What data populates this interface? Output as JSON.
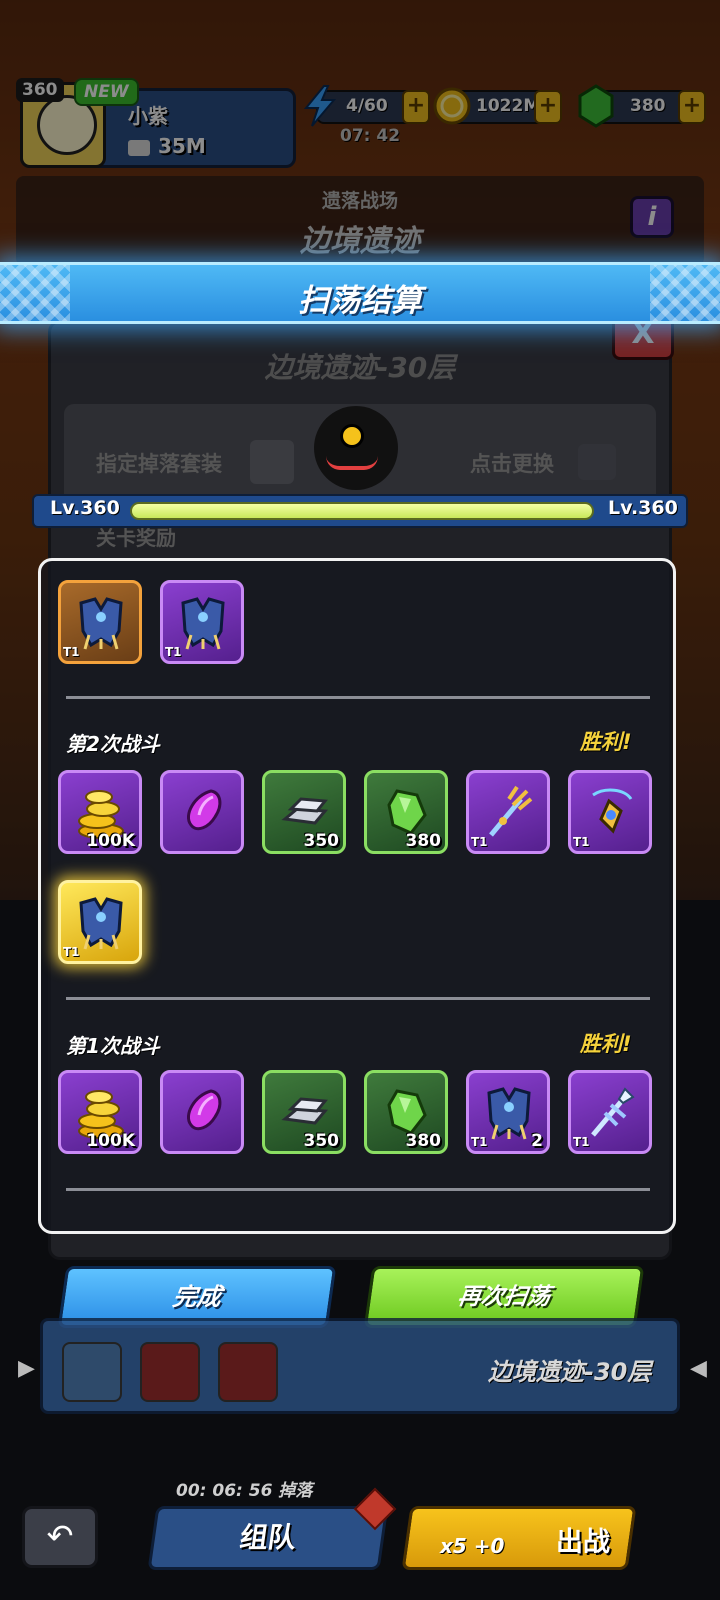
{
  "player": {
    "level": "360",
    "new_badge": "NEW",
    "name": "小紫",
    "power": "35M"
  },
  "resources": {
    "energy": "4/60",
    "energy_timer": "07: 42",
    "gold": "1022M",
    "gems": "380",
    "plus": "+"
  },
  "stage": {
    "subtitle": "遗落战场",
    "title": "边境遗迹",
    "info": "i"
  },
  "banner": {
    "title": "扫荡结算"
  },
  "dialog": {
    "title": "边境遗迹-30层",
    "close": "X",
    "drop_label": "指定掉落套装",
    "swap_label": "点击更换",
    "reward_label": "关卡奖励"
  },
  "level_bar": {
    "left": "Lv.360",
    "right": "Lv.360",
    "progress": 1.0
  },
  "results": {
    "initial_items": [
      {
        "icon": "armor-gauntlet-icon",
        "quality": "orange",
        "tier": "T1",
        "qty": ""
      },
      {
        "icon": "armor-gauntlet-icon",
        "quality": "purple",
        "tier": "T1",
        "qty": ""
      }
    ],
    "battles": [
      {
        "label": "第2次战斗",
        "result": "胜利!",
        "items": [
          {
            "icon": "gold-coins-icon",
            "quality": "purple",
            "tier": "",
            "qty": "100K"
          },
          {
            "icon": "purple-crystal-icon",
            "quality": "purple",
            "tier": "",
            "qty": ""
          },
          {
            "icon": "silver-ingot-icon",
            "quality": "green",
            "tier": "",
            "qty": "350"
          },
          {
            "icon": "green-gem-icon",
            "quality": "green",
            "tier": "",
            "qty": "380"
          },
          {
            "icon": "trident-icon",
            "quality": "purple",
            "tier": "T1",
            "qty": ""
          },
          {
            "icon": "amulet-icon",
            "quality": "purple",
            "tier": "T1",
            "qty": ""
          },
          {
            "icon": "armor-gauntlet-icon",
            "quality": "gold",
            "tier": "T1",
            "qty": ""
          }
        ]
      },
      {
        "label": "第1次战斗",
        "result": "胜利!",
        "items": [
          {
            "icon": "gold-coins-icon",
            "quality": "purple",
            "tier": "",
            "qty": "100K"
          },
          {
            "icon": "purple-crystal-icon",
            "quality": "purple",
            "tier": "",
            "qty": ""
          },
          {
            "icon": "silver-ingot-icon",
            "quality": "green",
            "tier": "",
            "qty": "350"
          },
          {
            "icon": "green-gem-icon",
            "quality": "green",
            "tier": "",
            "qty": "380"
          },
          {
            "icon": "armor-gauntlet-icon",
            "quality": "purple",
            "tier": "T1",
            "qty": "2"
          },
          {
            "icon": "spear-icon",
            "quality": "purple",
            "tier": "T1",
            "qty": ""
          }
        ]
      }
    ]
  },
  "buttons": {
    "done": "完成",
    "sweep_again": "再次扫荡"
  },
  "bottom": {
    "stage_name": "边境遗迹-30层",
    "sweep_timer": "00: 06: 56 掉落",
    "team": "组队",
    "fight": "出战",
    "fight_cost": "x5 +0"
  },
  "colors": {
    "banner": "#2a8fe0",
    "victory": "#f5d23c",
    "done_button": "#2b8ee6",
    "again_button": "#6cc81e",
    "quality_purple": "#8a3fcf",
    "quality_green": "#3f7a3c",
    "quality_orange": "#a86a2a",
    "quality_gold": "#ffd84a"
  }
}
